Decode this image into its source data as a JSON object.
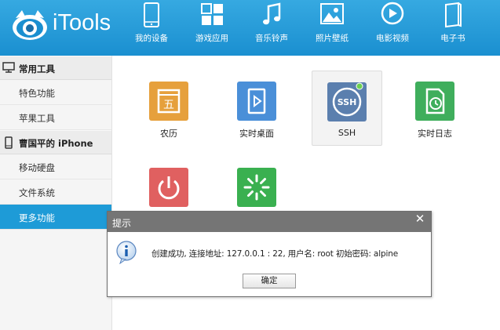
{
  "header": {
    "brand": "iTools",
    "nav": [
      {
        "label": "我的设备",
        "icon": "phone-icon"
      },
      {
        "label": "游戏应用",
        "icon": "apps-grid-icon"
      },
      {
        "label": "音乐铃声",
        "icon": "music-note-icon"
      },
      {
        "label": "照片壁纸",
        "icon": "photo-icon"
      },
      {
        "label": "电影视频",
        "icon": "play-circle-icon"
      },
      {
        "label": "电子书",
        "icon": "book-icon"
      }
    ],
    "accent_color": "#1e9bd7"
  },
  "sidebar": {
    "group1_title": "常用工具",
    "group1_items": [
      "特色功能",
      "苹果工具"
    ],
    "group2_title": "曹国平的 iPhone",
    "group2_items": [
      "移动硬盘",
      "文件系统",
      "更多功能"
    ],
    "active_item": "更多功能"
  },
  "main": {
    "tiles": [
      {
        "label": "农历",
        "icon": "calendar-icon",
        "color": "#e6a03c",
        "glyph": "五"
      },
      {
        "label": "实时桌面",
        "icon": "realtime-desktop-icon",
        "color": "#4a8fd8"
      },
      {
        "label": "SSH",
        "icon": "ssh-icon",
        "color": "#5b7fae",
        "glyph": "SSH"
      },
      {
        "label": "实时日志",
        "icon": "realtime-log-icon",
        "color": "#3fae5c"
      },
      {
        "label": "",
        "icon": "power-icon",
        "color": "#e06060"
      },
      {
        "label": "",
        "icon": "loading-spinner-icon",
        "color": "#3ab050"
      }
    ]
  },
  "dialog": {
    "title": "提示",
    "close": "✕",
    "message": "创建成功, 连接地址: 127.0.0.1 : 22, 用户名: root 初始密码: alpine",
    "ok_button": "确定"
  }
}
